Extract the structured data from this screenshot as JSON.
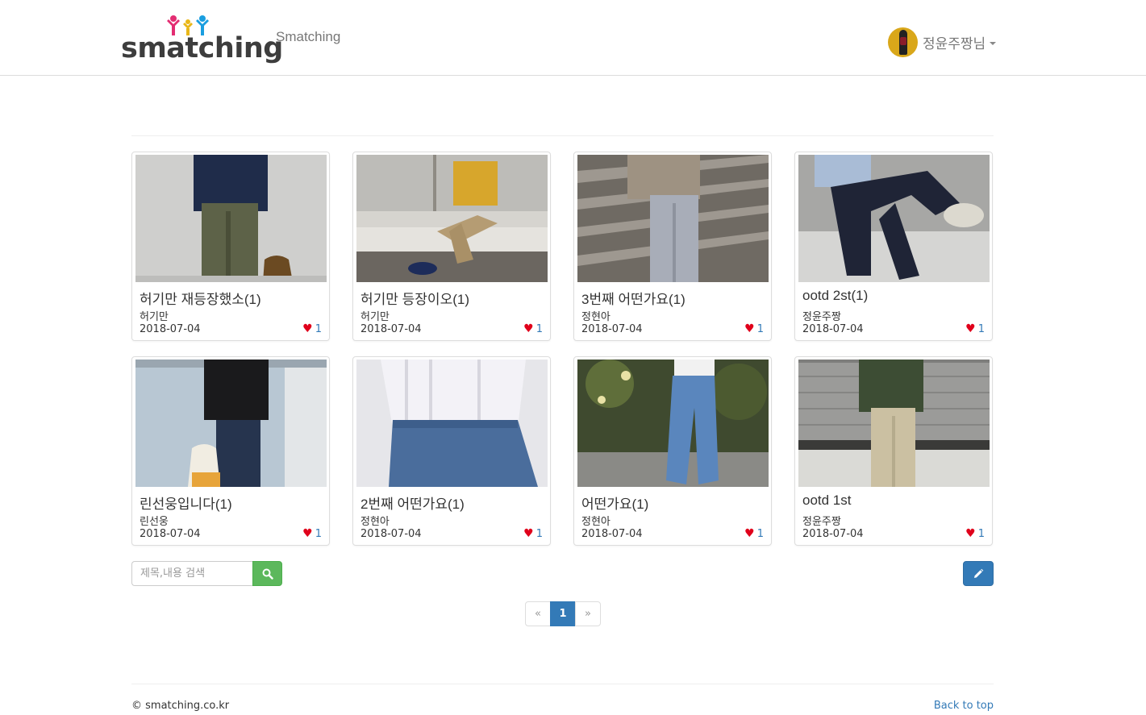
{
  "header": {
    "logo_text": "smatching",
    "brand_link": "Smatching",
    "user_name": "정윤주짱님",
    "accent_pink": "#e32d72",
    "accent_blue": "#1a9ee0"
  },
  "posts": [
    {
      "title": "허기만 재등장했소(1)",
      "author": "허기만",
      "date": "2018-07-04",
      "likes": "1"
    },
    {
      "title": "허기만 등장이오(1)",
      "author": "허기만",
      "date": "2018-07-04",
      "likes": "1"
    },
    {
      "title": "3번째 어떤가요(1)",
      "author": "정현아",
      "date": "2018-07-04",
      "likes": "1"
    },
    {
      "title": "ootd 2st(1)",
      "author": "정윤주짱",
      "date": "2018-07-04",
      "likes": "1"
    },
    {
      "title": "린선웅입니다(1)",
      "author": "린선웅",
      "date": "2018-07-04",
      "likes": "1"
    },
    {
      "title": "2번째 어떤가요(1)",
      "author": "정현아",
      "date": "2018-07-04",
      "likes": "1"
    },
    {
      "title": "어떤가요(1)",
      "author": "정현아",
      "date": "2018-07-04",
      "likes": "1"
    },
    {
      "title": "ootd 1st",
      "author": "정윤주짱",
      "date": "2018-07-04",
      "likes": "1"
    }
  ],
  "search": {
    "placeholder": "제목,내용 검색",
    "button_icon": "search-icon",
    "button_color": "#5cb85c"
  },
  "write_button": {
    "icon": "pencil-icon",
    "color": "#337ab7"
  },
  "pagination": {
    "prev": "«",
    "current": "1",
    "next": "»"
  },
  "footer": {
    "copyright": "© smatching.co.kr",
    "back_to_top": "Back to top"
  }
}
